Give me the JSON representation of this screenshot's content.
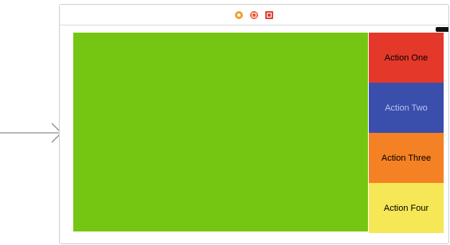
{
  "dock": {
    "icons": [
      "view-controller-icon",
      "first-responder-icon",
      "exit-icon"
    ]
  },
  "actions": [
    {
      "label": "Action One",
      "color": "#e3382a"
    },
    {
      "label": "Action Two",
      "color": "#3a4eac"
    },
    {
      "label": "Action Three",
      "color": "#f48123"
    },
    {
      "label": "Action Four",
      "color": "#f6e756"
    }
  ],
  "main_view": {
    "color": "#75c613"
  }
}
